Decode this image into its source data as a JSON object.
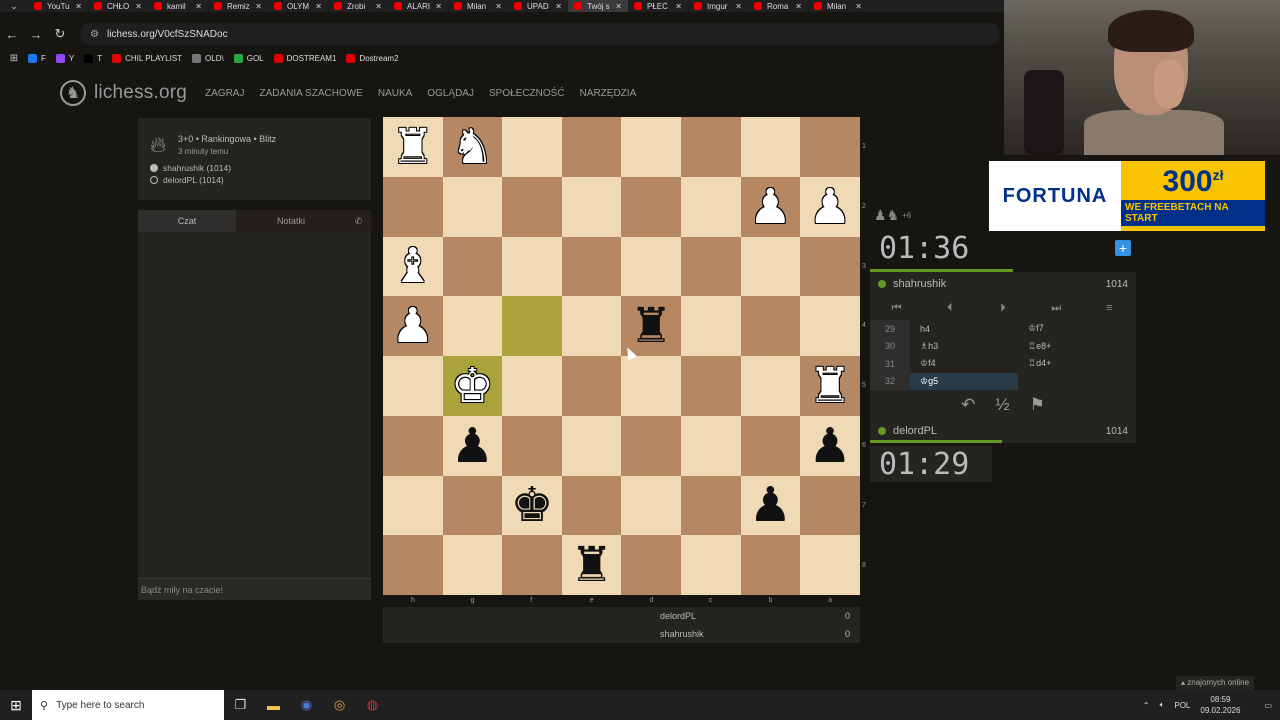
{
  "browser": {
    "tabs": [
      {
        "title": "YouTu",
        "active": false
      },
      {
        "title": "CHŁO",
        "active": false
      },
      {
        "title": "kamil",
        "active": false
      },
      {
        "title": "Remiz",
        "active": false
      },
      {
        "title": "OLYM",
        "active": false
      },
      {
        "title": "Zrobi",
        "active": false
      },
      {
        "title": "ALARI",
        "active": false
      },
      {
        "title": "Milan",
        "active": false
      },
      {
        "title": "UPAD",
        "active": false
      },
      {
        "title": "Twój s",
        "active": true
      },
      {
        "title": "PŁEĆ",
        "active": false
      },
      {
        "title": "Imgur",
        "active": false
      },
      {
        "title": "Roma",
        "active": false
      },
      {
        "title": "Milan",
        "active": false
      }
    ],
    "url": "lichess.org/V0cfSzSNADoc",
    "bookmarks": [
      {
        "label": "F",
        "color": "#1877f2"
      },
      {
        "label": "Y",
        "color": "#9146ff"
      },
      {
        "label": "T",
        "color": "#000000"
      },
      {
        "label": "CHIL PLAYLIST",
        "color": "#e00000"
      },
      {
        "label": "OLD\\",
        "color": "#777777"
      },
      {
        "label": "GOL",
        "color": "#29a745"
      },
      {
        "label": "DOSTREAM1",
        "color": "#e00000"
      },
      {
        "label": "Dostream2",
        "color": "#e00000"
      }
    ]
  },
  "site": {
    "logo": "lichess.org",
    "nav": [
      "ZAGRAJ",
      "ZADANIA SZACHOWE",
      "NAUKA",
      "OGLĄDAJ",
      "SPOŁECZNOŚĆ",
      "NARZĘDZIA"
    ]
  },
  "game": {
    "mode": "3+0 • Rankingowa • Blitz",
    "time_ago": "3 minuty temu",
    "white_player": "shahrushik (1014)",
    "black_player": "delordPL (1014)"
  },
  "chat": {
    "tab_chat": "Czat",
    "tab_notes": "Notatki",
    "placeholder": "Bądź miły na czacie!"
  },
  "board": {
    "rank_labels": [
      "1",
      "2",
      "3",
      "4",
      "5",
      "6",
      "7",
      "8"
    ],
    "file_labels": [
      "h",
      "g",
      "f",
      "e",
      "d",
      "c",
      "b",
      "a"
    ],
    "rows": [
      [
        "wR",
        "wN",
        "",
        "",
        "",
        "",
        "",
        ""
      ],
      [
        "",
        "",
        "",
        "",
        "",
        "",
        "wP",
        "wP"
      ],
      [
        "wB",
        "",
        "",
        "",
        "",
        "",
        "",
        ""
      ],
      [
        "wP",
        "",
        "HL",
        "",
        "bR",
        "",
        "",
        ""
      ],
      [
        "",
        "wK*",
        "",
        "",
        "",
        "",
        "",
        "wR"
      ],
      [
        "",
        "bP",
        "",
        "",
        "",
        "",
        "",
        "bP"
      ],
      [
        "",
        "",
        "bK",
        "",
        "",
        "",
        "bP",
        ""
      ],
      [
        "",
        "",
        "",
        "bR",
        "",
        "",
        "",
        ""
      ]
    ]
  },
  "score": [
    {
      "name": "delordPL",
      "points": "0"
    },
    {
      "name": "shahrushik",
      "points": "0"
    }
  ],
  "right": {
    "material_plus": "+6",
    "top_clock": "01:36",
    "top_player": "shahrushik",
    "top_rating": "1014",
    "moves": [
      {
        "n": "29",
        "w": "h4",
        "b": "♔f7"
      },
      {
        "n": "30",
        "w": "♗h3",
        "b": "♖e8+"
      },
      {
        "n": "31",
        "w": "♔f4",
        "b": "♖d4+"
      },
      {
        "n": "32",
        "w": "♔g5",
        "b": ""
      }
    ],
    "bottom_player": "delordPL",
    "bottom_rating": "1014",
    "bottom_clock": "01:29"
  },
  "ad": {
    "brand": "FORTUNA",
    "amount": "300",
    "currency": "zł",
    "tag": "WE FREEBETACH NA START"
  },
  "friends": "znajomych online",
  "taskbar": {
    "search": "Type here to search",
    "lang": "POL",
    "time": "08:59",
    "date": "09.02.2026"
  }
}
